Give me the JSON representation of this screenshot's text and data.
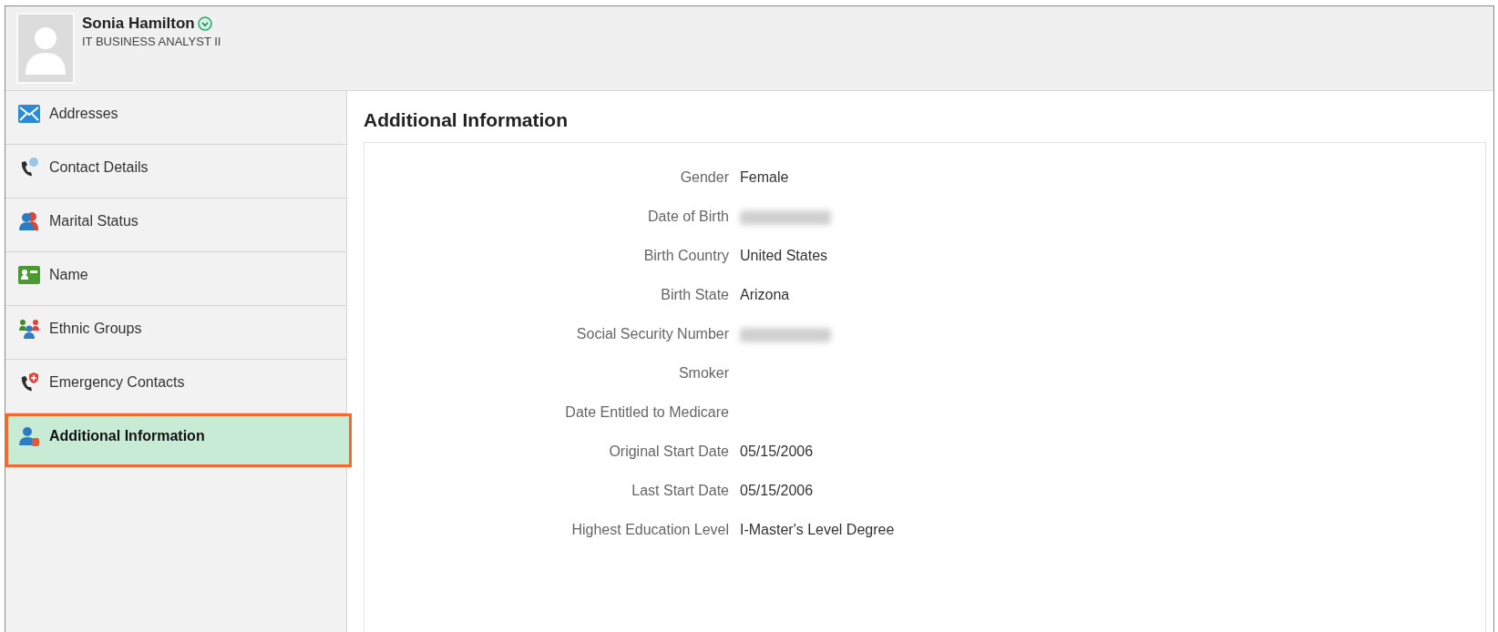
{
  "header": {
    "name": "Sonia Hamilton",
    "job_title": "IT BUSINESS ANALYST II"
  },
  "sidebar": {
    "items": [
      {
        "label": "Addresses",
        "selected": false
      },
      {
        "label": "Contact Details",
        "selected": false
      },
      {
        "label": "Marital Status",
        "selected": false
      },
      {
        "label": "Name",
        "selected": false
      },
      {
        "label": "Ethnic Groups",
        "selected": false
      },
      {
        "label": "Emergency Contacts",
        "selected": false
      },
      {
        "label": "Additional Information",
        "selected": true
      }
    ]
  },
  "content": {
    "title": "Additional Information",
    "fields": [
      {
        "label": "Gender",
        "kind": "text",
        "value": "Female"
      },
      {
        "label": "Date of Birth",
        "kind": "redacted"
      },
      {
        "label": "Birth Country",
        "kind": "text",
        "value": "United States"
      },
      {
        "label": "Birth State",
        "kind": "text",
        "value": "Arizona"
      },
      {
        "label": "Social Security Number",
        "kind": "redacted"
      },
      {
        "label": "Smoker",
        "kind": "empty"
      },
      {
        "label": "Date Entitled to Medicare",
        "kind": "empty"
      },
      {
        "label": "Original Start Date",
        "kind": "text",
        "value": "05/15/2006"
      },
      {
        "label": "Last Start Date",
        "kind": "text",
        "value": "05/15/2006"
      },
      {
        "label": "Highest Education Level",
        "kind": "text",
        "value": "I-Master's Level Degree"
      }
    ]
  }
}
